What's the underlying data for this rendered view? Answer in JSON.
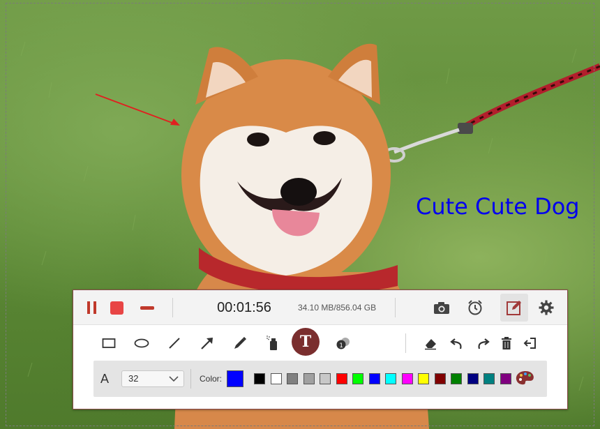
{
  "annotation": {
    "text": "Cute Cute Dog",
    "color": "#0000ee"
  },
  "recorder": {
    "timer": "00:01:56",
    "size_info": "34.10 MB/856.04 GB",
    "buttons": {
      "pause": "pause-icon",
      "stop": "stop-icon",
      "minimize": "minimize-icon",
      "screenshot": "camera-icon",
      "schedule": "alarm-clock-icon",
      "edit": "edit-icon",
      "settings": "gear-icon"
    }
  },
  "tools": [
    {
      "name": "rectangle-tool",
      "icon": "rectangle-icon"
    },
    {
      "name": "ellipse-tool",
      "icon": "ellipse-icon"
    },
    {
      "name": "line-tool",
      "icon": "line-icon"
    },
    {
      "name": "arrow-tool",
      "icon": "arrow-icon"
    },
    {
      "name": "pencil-tool",
      "icon": "pencil-icon"
    },
    {
      "name": "spray-tool",
      "icon": "spray-icon"
    },
    {
      "name": "text-tool",
      "icon": "text-icon",
      "label": "T",
      "active": true
    },
    {
      "name": "step-number-tool",
      "icon": "numbered-callout-icon"
    },
    {
      "name": "eraser-tool",
      "icon": "eraser-icon"
    },
    {
      "name": "undo-tool",
      "icon": "undo-icon"
    },
    {
      "name": "redo-tool",
      "icon": "redo-icon"
    },
    {
      "name": "delete-tool",
      "icon": "trash-icon"
    },
    {
      "name": "exit-tool",
      "icon": "exit-icon"
    }
  ],
  "properties": {
    "font_label": "A",
    "font_size": "32",
    "color_label": "Color:",
    "current_color": "#0000ff",
    "swatches": [
      "#000000",
      "#ffffff",
      "#808080",
      "#a0a0a0",
      "#c8c8c8",
      "#ff0000",
      "#00ff00",
      "#0000ff",
      "#00ffff",
      "#ff00ff",
      "#ffff00",
      "#800000",
      "#008000",
      "#000080",
      "#008080",
      "#800080"
    ],
    "palette_icon": "palette-icon"
  },
  "theme": {
    "accent": "#c0392b",
    "text_tool_bg": "#7a2e2e"
  }
}
